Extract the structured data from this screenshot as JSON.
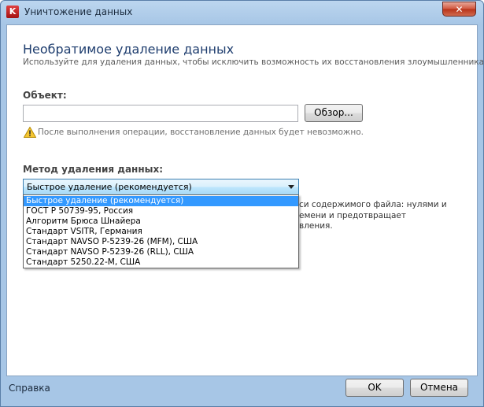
{
  "window": {
    "title": "Уничтожение данных",
    "icon": "kaspersky-k-icon",
    "close_label": "✕"
  },
  "header": {
    "title": "Необратимое удаление данных",
    "subtitle": "Используйте для удаления данных, чтобы исключить возможность их восстановления злоумышленниками."
  },
  "object": {
    "label": "Объект:",
    "value": "",
    "browse_label": "Обзор...",
    "warning_icon": "warning-icon",
    "warning_text": "После выполнения операции, восстановление данных будет невозможно."
  },
  "method": {
    "label": "Метод удаления данных:",
    "selected": "Быстрое удаление (рекомендуется)",
    "options": [
      "Быстрое удаление (рекомендуется)",
      "ГОСТ Р 50739-95, Россия",
      "Алгоритм Брюса Шнайера",
      "Стандарт VSITR, Германия",
      "Стандарт NAVSO P-5239-26 (MFM), США",
      "Стандарт NAVSO P-5239-26 (RLL), США",
      "Стандарт 5250.22-M, США"
    ],
    "description_lines": [
      "си содержимого файла: нулями и",
      "емени и предотвращает",
      "вления."
    ]
  },
  "footer": {
    "help_label": "Справка",
    "ok_label": "OK",
    "cancel_label": "Отмена"
  },
  "colors": {
    "title_text": "#1e3d6e",
    "selection": "#3399ff",
    "frame": "#a7c6e6"
  }
}
